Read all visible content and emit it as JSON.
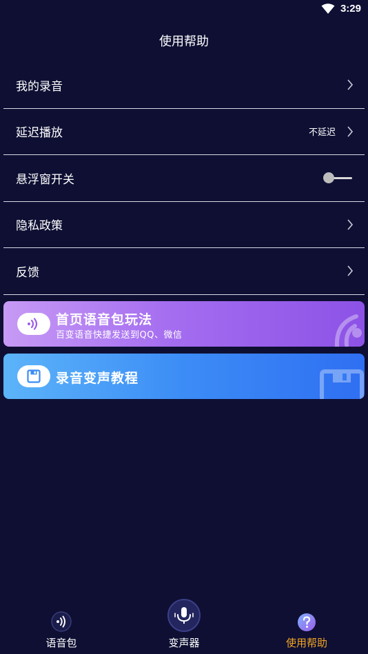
{
  "status_bar": {
    "time": "3:29"
  },
  "header": {
    "title": "使用帮助"
  },
  "settings": {
    "my_recordings": {
      "label": "我的录音"
    },
    "delay_playback": {
      "label": "延迟播放",
      "value": "不延迟"
    },
    "floating_window": {
      "label": "悬浮窗开关",
      "enabled": false
    },
    "privacy_policy": {
      "label": "隐私政策"
    },
    "feedback": {
      "label": "反馈"
    }
  },
  "banners": {
    "voice_pack_guide": {
      "title": "首页语音包玩法",
      "subtitle": "百变语音快捷发送到QQ、微信"
    },
    "recording_tutorial": {
      "title": "录音变声教程"
    }
  },
  "bottom_nav": {
    "items": [
      {
        "label": "语音包",
        "icon": "sound-wave-icon",
        "active": false
      },
      {
        "label": "变声器",
        "icon": "microphone-icon",
        "active": false
      },
      {
        "label": "使用帮助",
        "icon": "question-mark-icon",
        "active": true
      }
    ]
  },
  "colors": {
    "background": "#0e0f33",
    "active_tab": "#f4a623",
    "banner_purple": "#a56ef0",
    "banner_blue": "#3c8cf6"
  }
}
